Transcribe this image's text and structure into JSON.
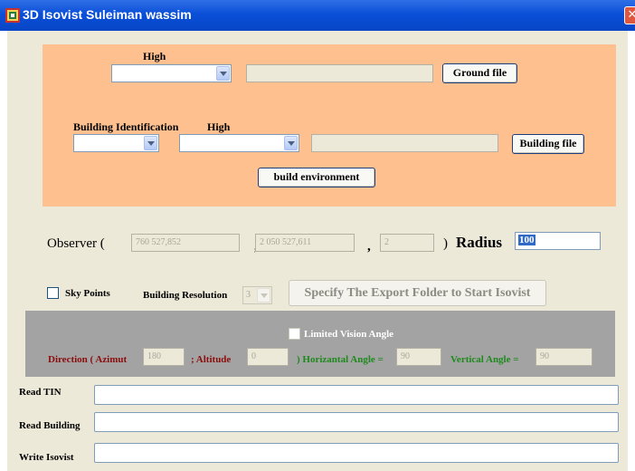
{
  "window": {
    "title": "3D Isovist Suleiman wassim",
    "close_glyph": "✕"
  },
  "ground": {
    "high_label": "High",
    "file_button": "Ground file"
  },
  "building": {
    "identification_label": "Building Identification",
    "high_label": "High",
    "file_button": "Building file",
    "build_button": "build environment"
  },
  "observer": {
    "label": "Observer (",
    "x": "760 527,852",
    "sep1": ",",
    "y": "2 050 527,611",
    "sep2": ",",
    "z": "2",
    "close": ")",
    "radius_label": "Radius",
    "radius_value": "100"
  },
  "options": {
    "sky_points_label": "Sky Points",
    "resolution_label": "Building Resolution",
    "resolution_value": "3",
    "export_button": "Specify The Export Folder to Start Isovist"
  },
  "vision": {
    "limited_label": "Limited Vision Angle",
    "direction_label": "Direction ( Azimut",
    "direction_value": "180",
    "altitude_label": "; Altitude",
    "altitude_value": "0",
    "horizontal_label": ") Horizantal Angle =",
    "horizontal_value": "90",
    "vertical_label": "Vertical Angle =",
    "vertical_value": "90"
  },
  "files": {
    "read_tin": "Read TIN",
    "read_building": "Read Building",
    "write_isovist": "Write Isovist"
  },
  "colors": {
    "titlebar": "#0a4fd8",
    "client": "#ece9d8",
    "orange_panel": "#ffc090",
    "gray_panel": "#a3a3a3",
    "red_text": "#8b0d0d",
    "green_text": "#1e8a1e"
  }
}
